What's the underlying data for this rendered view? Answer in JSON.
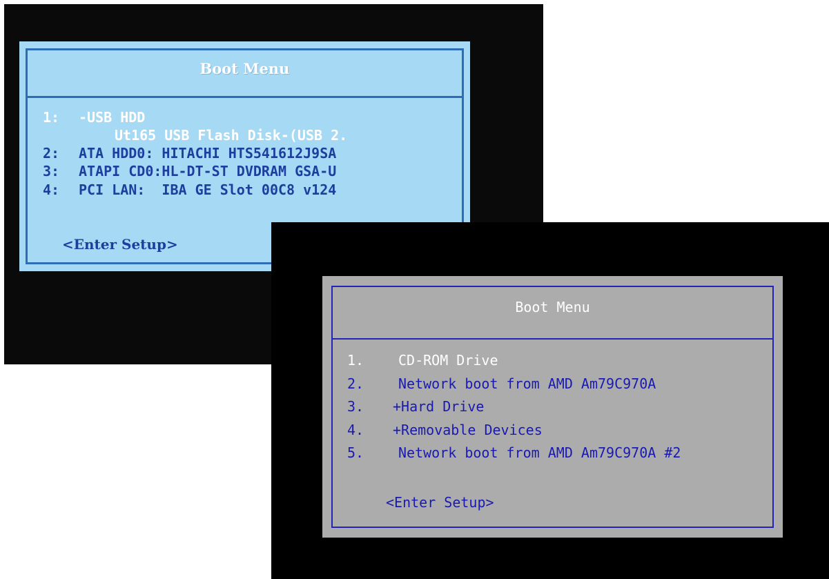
{
  "screen1": {
    "title": "Boot Menu",
    "items": [
      {
        "num": "1:",
        "label": "-USB HDD",
        "sub": "Ut165 USB Flash Disk-(USB 2."
      },
      {
        "num": "2:",
        "label": "ATA HDD0: HITACHI HTS541612J9SA"
      },
      {
        "num": "3:",
        "label": "ATAPI CD0:HL-DT-ST DVDRAM GSA-U"
      },
      {
        "num": "4:",
        "label": "PCI LAN:  IBA GE Slot 00C8 v124"
      }
    ],
    "enter_setup": "<Enter Setup>",
    "colors": {
      "background": "#a6d9f4",
      "frame": "#2c6db5",
      "text": "#1c3f9e",
      "highlight": "#ffffff"
    }
  },
  "screen2": {
    "title": "Boot Menu",
    "items": [
      {
        "num": "1.",
        "label": "CD-ROM Drive"
      },
      {
        "num": "2.",
        "label": "Network boot from AMD Am79C970A"
      },
      {
        "num": "3.",
        "label": "+Hard Drive"
      },
      {
        "num": "4.",
        "label": "+Removable Devices"
      },
      {
        "num": "5.",
        "label": "Network boot from AMD Am79C970A #2"
      }
    ],
    "enter_setup": "<Enter Setup>",
    "colors": {
      "background": "#acacac",
      "frame": "#2323b8",
      "text": "#1a1ab0",
      "highlight": "#ffffff"
    }
  }
}
